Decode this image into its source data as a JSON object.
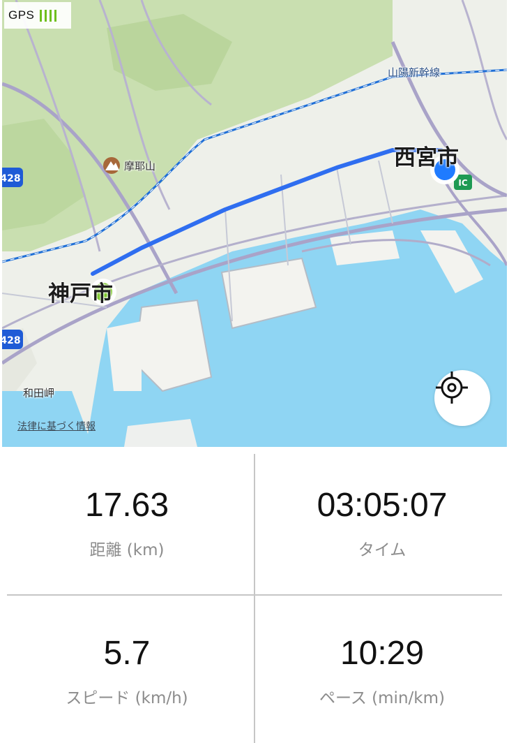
{
  "gps": {
    "label": "GPS",
    "signal_bars": 4,
    "signal_color": "#6fbf1e"
  },
  "map": {
    "labels": {
      "kobe": "神戸市",
      "nishinomiya": "西宮市",
      "mount_maya": "摩耶山",
      "wadamisaki": "和田岬",
      "shinkansen": "山陽新幹線",
      "route_428_a": "428",
      "route_428_b": "428",
      "ic_badge": "IC"
    },
    "legal_link": "法律に基づく情報",
    "colors": {
      "route": "#2f6ef0",
      "start_marker": "#6cc110",
      "end_marker": "#1f7bff",
      "water": "#8fd5f3",
      "land": "#eef0ea",
      "green": "#c9dfb0"
    }
  },
  "stats": {
    "distance": {
      "value": "17.63",
      "label": "距離 (km)"
    },
    "time": {
      "value": "03:05:07",
      "label": "タイム"
    },
    "speed": {
      "value": "5.7",
      "label": "スピード (km/h)"
    },
    "pace": {
      "value": "10:29",
      "label": "ペース (min/km)"
    }
  }
}
